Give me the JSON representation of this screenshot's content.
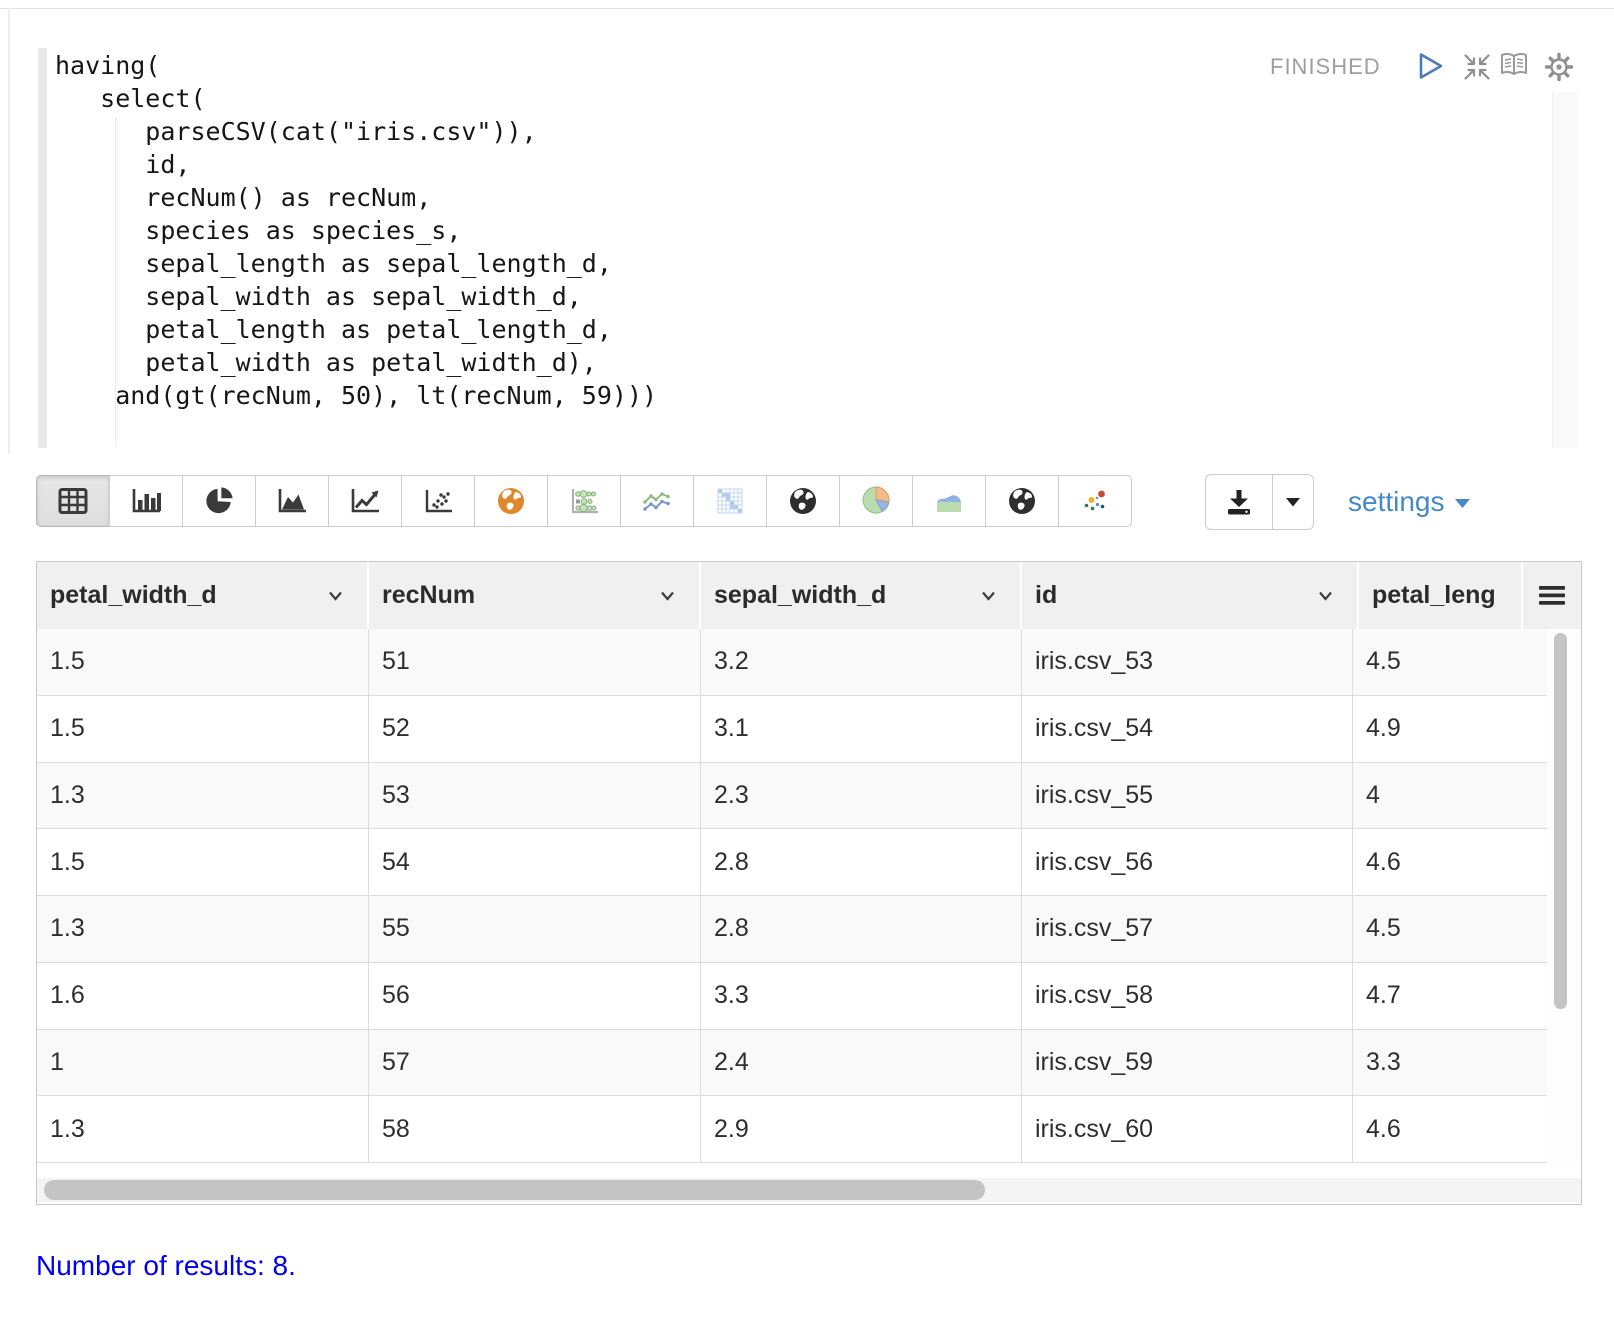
{
  "paragraph": {
    "status": "FINISHED",
    "code_lines": [
      "having(",
      "   select(",
      "      parseCSV(cat(\"iris.csv\")),",
      "      id,",
      "      recNum() as recNum,",
      "      species as species_s,",
      "      sepal_length as sepal_length_d,",
      "      sepal_width as sepal_width_d,",
      "      petal_length as petal_length_d,",
      "      petal_width as petal_width_d),",
      "    and(gt(recNum, 50), lt(recNum, 59)))"
    ],
    "controls": [
      {
        "icon": "run-icon"
      },
      {
        "icon": "collapse-icon"
      },
      {
        "icon": "book-icon"
      },
      {
        "icon": "gear-icon"
      }
    ]
  },
  "toolbar": {
    "chart_buttons": [
      {
        "icon": "table-icon",
        "selected": true
      },
      {
        "icon": "bar-chart-icon",
        "selected": false
      },
      {
        "icon": "pie-chart-icon",
        "selected": false
      },
      {
        "icon": "area-chart-icon",
        "selected": false
      },
      {
        "icon": "line-chart-icon",
        "selected": false
      },
      {
        "icon": "scatter-chart-icon",
        "selected": false
      },
      {
        "icon": "globe-orange-icon",
        "selected": false
      },
      {
        "icon": "bubble-chart-icon",
        "selected": false
      },
      {
        "icon": "multi-line-chart-icon",
        "selected": false
      },
      {
        "icon": "matrix-chart-icon",
        "selected": false
      },
      {
        "icon": "globe-dark-icon",
        "selected": false
      },
      {
        "icon": "pie-chart-color-icon",
        "selected": false
      },
      {
        "icon": "stacked-area-chart-icon",
        "selected": false
      },
      {
        "icon": "globe-dark-icon",
        "selected": false
      },
      {
        "icon": "scatter-color-icon",
        "selected": false
      }
    ],
    "download": {
      "icon": "download-icon",
      "caret": "caret-down-icon"
    },
    "settings_label": "settings"
  },
  "table": {
    "columns": [
      {
        "label": "petal_width_d"
      },
      {
        "label": "recNum"
      },
      {
        "label": "sepal_width_d"
      },
      {
        "label": "id"
      },
      {
        "label": "petal_leng"
      }
    ],
    "rows": [
      [
        "1.5",
        "51",
        "3.2",
        "iris.csv_53",
        "4.5"
      ],
      [
        "1.5",
        "52",
        "3.1",
        "iris.csv_54",
        "4.9"
      ],
      [
        "1.3",
        "53",
        "2.3",
        "iris.csv_55",
        "4"
      ],
      [
        "1.5",
        "54",
        "2.8",
        "iris.csv_56",
        "4.6"
      ],
      [
        "1.3",
        "55",
        "2.8",
        "iris.csv_57",
        "4.5"
      ],
      [
        "1.6",
        "56",
        "3.3",
        "iris.csv_58",
        "4.7"
      ],
      [
        "1",
        "57",
        "2.4",
        "iris.csv_59",
        "3.3"
      ],
      [
        "1.3",
        "58",
        "2.9",
        "iris.csv_60",
        "4.6"
      ]
    ]
  },
  "footer": {
    "results_text": "Number of results: 8."
  },
  "colors": {
    "settings_link": "#4489c8",
    "results_link": "#0000ee",
    "status_text": "#9e9e9e",
    "globe_orange": "#e0862c",
    "selected_button_bg": "#e4e4e4",
    "header_bg": "#f0f0f0",
    "row_stripe": "#f9f9f9",
    "scrollbar_thumb": "#c4c4c4",
    "run_icon_blue": "#4a7db5"
  }
}
